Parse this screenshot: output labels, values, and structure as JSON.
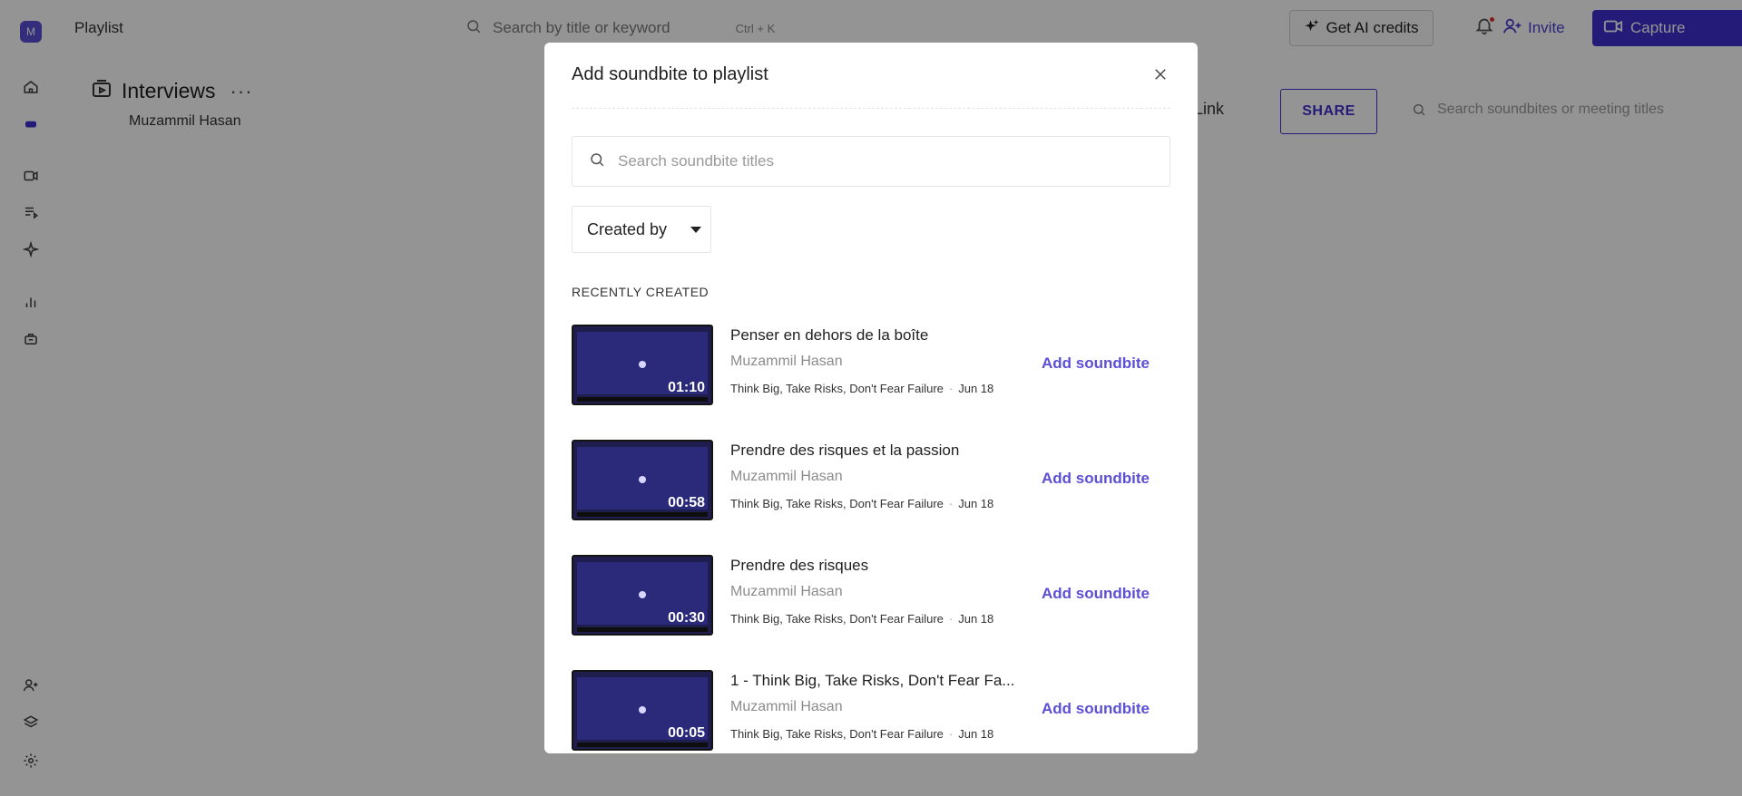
{
  "sidebar": {
    "logo_letter": "M",
    "icons": [
      "home-icon",
      "workspace-icon",
      "video-icon",
      "playlist-icon",
      "sparkle-icon",
      "analytics-icon",
      "integrations-icon",
      "add-user-icon",
      "layers-icon",
      "settings-icon"
    ]
  },
  "topbar": {
    "breadcrumb": "Playlist",
    "search_placeholder": "Search by title or keyword",
    "search_shortcut": "Ctrl + K",
    "credits_label": "Get AI credits",
    "invite_label": "Invite",
    "capture_label": "Capture"
  },
  "page": {
    "title": "Interviews",
    "owner": "Muzammil Hasan",
    "link_label": "Link",
    "share_label": "SHARE",
    "search_placeholder": "Search soundbites or meeting titles"
  },
  "modal": {
    "title": "Add soundbite to playlist",
    "search_placeholder": "Search soundbite titles",
    "filter_label": "Created by",
    "section_label": "RECENTLY CREATED",
    "add_label": "Add soundbite",
    "items": [
      {
        "title": "Penser en dehors de la boîte",
        "author": "Muzammil Hasan",
        "meeting": "Think Big, Take Risks, Don't Fear Failure",
        "date": "Jun 18",
        "duration": "01:10"
      },
      {
        "title": "Prendre des risques et la passion",
        "author": "Muzammil Hasan",
        "meeting": "Think Big, Take Risks, Don't Fear Failure",
        "date": "Jun 18",
        "duration": "00:58"
      },
      {
        "title": "Prendre des risques",
        "author": "Muzammil Hasan",
        "meeting": "Think Big, Take Risks, Don't Fear Failure",
        "date": "Jun 18",
        "duration": "00:30"
      },
      {
        "title": "1 - Think Big, Take Risks, Don't Fear Fa...",
        "author": "Muzammil Hasan",
        "meeting": "Think Big, Take Risks, Don't Fear Failure",
        "date": "Jun 18",
        "duration": "00:05"
      }
    ]
  },
  "colors": {
    "accent": "#3f2fd1",
    "link": "#5b4fd6",
    "overlay": "rgba(0,0,0,0.42)"
  }
}
